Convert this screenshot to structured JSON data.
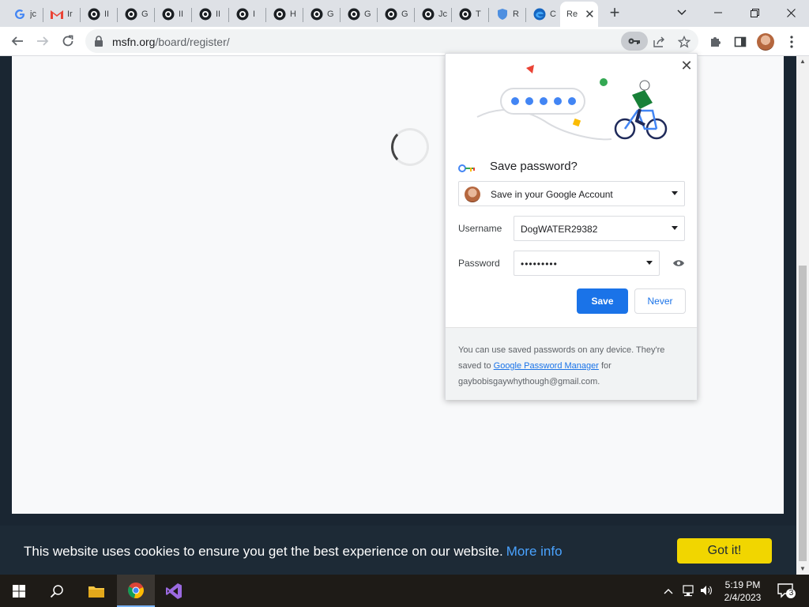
{
  "tabs": [
    {
      "title": "jc",
      "icon": "google-g-icon"
    },
    {
      "title": "Ir",
      "icon": "gmail-icon"
    },
    {
      "title": "II",
      "icon": "github-icon"
    },
    {
      "title": "G",
      "icon": "github-icon"
    },
    {
      "title": "II",
      "icon": "github-icon"
    },
    {
      "title": "II",
      "icon": "github-icon"
    },
    {
      "title": "I",
      "icon": "github-icon"
    },
    {
      "title": "H",
      "icon": "github-icon"
    },
    {
      "title": "G",
      "icon": "github-icon"
    },
    {
      "title": "G",
      "icon": "github-icon"
    },
    {
      "title": "G",
      "icon": "github-icon"
    },
    {
      "title": "Jc",
      "icon": "github-icon"
    },
    {
      "title": "T",
      "icon": "github-icon"
    },
    {
      "title": "R",
      "icon": "shield-icon"
    },
    {
      "title": "C",
      "icon": "edge-icon"
    }
  ],
  "active_tab": {
    "title": "Re",
    "close": "✕"
  },
  "new_tab": "+",
  "window": {
    "minimize": "—",
    "restore": "❐",
    "close": "✕",
    "tabsearch": "⌄"
  },
  "address": {
    "host": "msfn.org",
    "path": "/board/register/"
  },
  "cookie": {
    "message": "This website uses cookies to ensure you get the best experience on our website.",
    "more": "More info",
    "button": "Got it!"
  },
  "password_bubble": {
    "title": "Save password?",
    "destination": "Save in your Google Account",
    "username_label": "Username",
    "username_value": "DogWATER29382",
    "password_label": "Password",
    "password_value": "•••••••••",
    "save": "Save",
    "never": "Never",
    "footer_pre": "You can use saved passwords on any device. They're saved to ",
    "footer_link": "Google Password Manager",
    "footer_mid": " for",
    "footer_email": "gaybobisgaywhythough@gmail.com."
  },
  "taskbar": {
    "time": "5:19 PM",
    "date": "2/4/2023",
    "notifications": "3"
  },
  "colors": {
    "accent": "#1a73e8",
    "cookie_button": "#f1d600",
    "cookie_link": "#4aa3ff"
  }
}
